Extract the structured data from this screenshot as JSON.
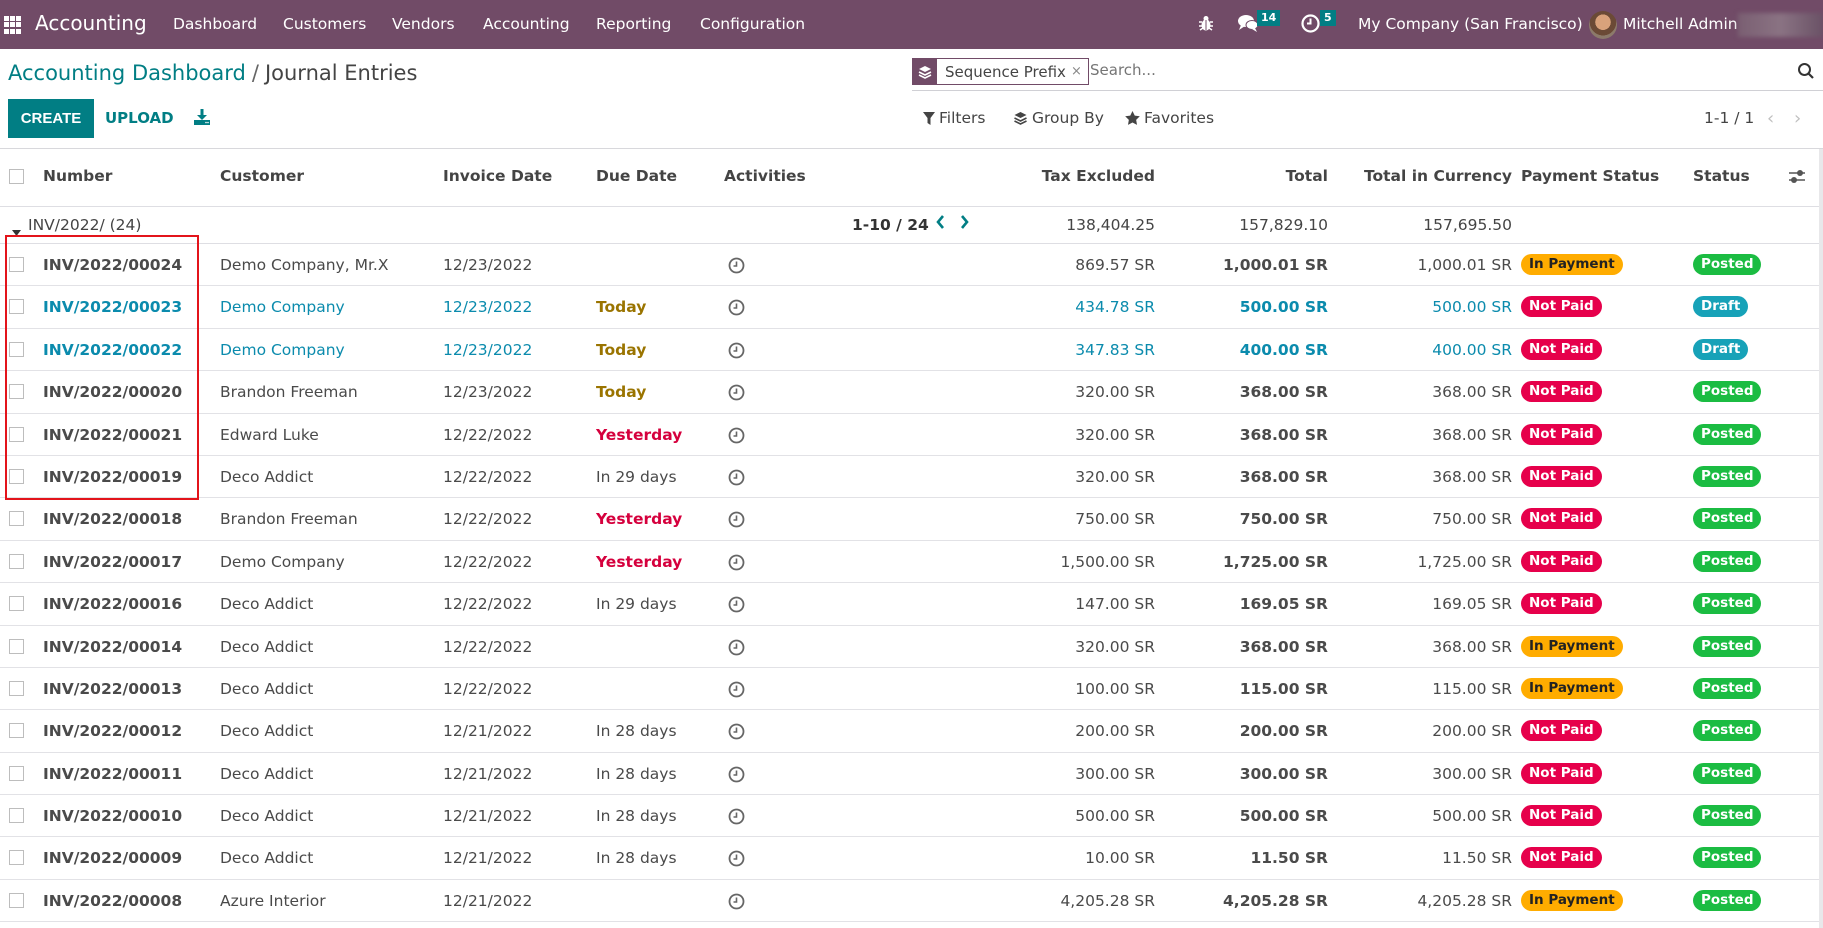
{
  "navbar": {
    "app_name": "Accounting",
    "menu": [
      "Dashboard",
      "Customers",
      "Vendors",
      "Accounting",
      "Reporting",
      "Configuration"
    ],
    "messages_count": "14",
    "activities_count": "5",
    "company": "My Company (San Francisco)",
    "user": "Mitchell Admin"
  },
  "breadcrumb": {
    "parent": "Accounting Dashboard",
    "separator": "/",
    "current": "Journal Entries"
  },
  "toolbar": {
    "create_label": "CREATE",
    "upload_label": "UPLOAD"
  },
  "search": {
    "facet_label": "Sequence Prefix",
    "facet_close": "×",
    "placeholder": "Search...",
    "filters_label": "Filters",
    "groupby_label": "Group By",
    "favorites_label": "Favorites"
  },
  "pager": {
    "value": "1-1 / 1",
    "prev": "‹",
    "next": "›"
  },
  "table": {
    "columns": [
      "Number",
      "Customer",
      "Invoice Date",
      "Due Date",
      "Activities",
      "Tax Excluded",
      "Total",
      "Total in Currency",
      "Payment Status",
      "Status"
    ],
    "group": {
      "label": "INV/2022/ (24)",
      "pager": "1-10 / 24",
      "tax_excluded": "138,404.25",
      "total": "157,829.10",
      "total_in_currency": "157,695.50"
    },
    "rows": [
      {
        "number": "INV/2022/00024",
        "customer": "Demo Company, Mr.X",
        "invoice_date": "12/23/2022",
        "due_date": "",
        "due_kind": "",
        "tax_excluded": "869.57 SR",
        "total": "1,000.01 SR",
        "total_in_currency": "1,000.01 SR",
        "payment_status": "In Payment",
        "payment_kind": "in-payment",
        "status": "Posted",
        "status_kind": "posted"
      },
      {
        "number": "INV/2022/00023",
        "customer": "Demo Company",
        "invoice_date": "12/23/2022",
        "due_date": "Today",
        "due_kind": "today",
        "tax_excluded": "434.78 SR",
        "total": "500.00 SR",
        "total_in_currency": "500.00 SR",
        "payment_status": "Not Paid",
        "payment_kind": "not-paid",
        "status": "Draft",
        "status_kind": "draft"
      },
      {
        "number": "INV/2022/00022",
        "customer": "Demo Company",
        "invoice_date": "12/23/2022",
        "due_date": "Today",
        "due_kind": "today",
        "tax_excluded": "347.83 SR",
        "total": "400.00 SR",
        "total_in_currency": "400.00 SR",
        "payment_status": "Not Paid",
        "payment_kind": "not-paid",
        "status": "Draft",
        "status_kind": "draft"
      },
      {
        "number": "INV/2022/00020",
        "customer": "Brandon Freeman",
        "invoice_date": "12/23/2022",
        "due_date": "Today",
        "due_kind": "today",
        "tax_excluded": "320.00 SR",
        "total": "368.00 SR",
        "total_in_currency": "368.00 SR",
        "payment_status": "Not Paid",
        "payment_kind": "not-paid",
        "status": "Posted",
        "status_kind": "posted"
      },
      {
        "number": "INV/2022/00021",
        "customer": "Edward Luke",
        "invoice_date": "12/22/2022",
        "due_date": "Yesterday",
        "due_kind": "late",
        "tax_excluded": "320.00 SR",
        "total": "368.00 SR",
        "total_in_currency": "368.00 SR",
        "payment_status": "Not Paid",
        "payment_kind": "not-paid",
        "status": "Posted",
        "status_kind": "posted"
      },
      {
        "number": "INV/2022/00019",
        "customer": "Deco Addict",
        "invoice_date": "12/22/2022",
        "due_date": "In 29 days",
        "due_kind": "",
        "tax_excluded": "320.00 SR",
        "total": "368.00 SR",
        "total_in_currency": "368.00 SR",
        "payment_status": "Not Paid",
        "payment_kind": "not-paid",
        "status": "Posted",
        "status_kind": "posted"
      },
      {
        "number": "INV/2022/00018",
        "customer": "Brandon Freeman",
        "invoice_date": "12/22/2022",
        "due_date": "Yesterday",
        "due_kind": "late",
        "tax_excluded": "750.00 SR",
        "total": "750.00 SR",
        "total_in_currency": "750.00 SR",
        "payment_status": "Not Paid",
        "payment_kind": "not-paid",
        "status": "Posted",
        "status_kind": "posted"
      },
      {
        "number": "INV/2022/00017",
        "customer": "Demo Company",
        "invoice_date": "12/22/2022",
        "due_date": "Yesterday",
        "due_kind": "late",
        "tax_excluded": "1,500.00 SR",
        "total": "1,725.00 SR",
        "total_in_currency": "1,725.00 SR",
        "payment_status": "Not Paid",
        "payment_kind": "not-paid",
        "status": "Posted",
        "status_kind": "posted"
      },
      {
        "number": "INV/2022/00016",
        "customer": "Deco Addict",
        "invoice_date": "12/22/2022",
        "due_date": "In 29 days",
        "due_kind": "",
        "tax_excluded": "147.00 SR",
        "total": "169.05 SR",
        "total_in_currency": "169.05 SR",
        "payment_status": "Not Paid",
        "payment_kind": "not-paid",
        "status": "Posted",
        "status_kind": "posted"
      },
      {
        "number": "INV/2022/00014",
        "customer": "Deco Addict",
        "invoice_date": "12/22/2022",
        "due_date": "",
        "due_kind": "",
        "tax_excluded": "320.00 SR",
        "total": "368.00 SR",
        "total_in_currency": "368.00 SR",
        "payment_status": "In Payment",
        "payment_kind": "in-payment",
        "status": "Posted",
        "status_kind": "posted"
      },
      {
        "number": "INV/2022/00013",
        "customer": "Deco Addict",
        "invoice_date": "12/22/2022",
        "due_date": "",
        "due_kind": "",
        "tax_excluded": "100.00 SR",
        "total": "115.00 SR",
        "total_in_currency": "115.00 SR",
        "payment_status": "In Payment",
        "payment_kind": "in-payment",
        "status": "Posted",
        "status_kind": "posted"
      },
      {
        "number": "INV/2022/00012",
        "customer": "Deco Addict",
        "invoice_date": "12/21/2022",
        "due_date": "In 28 days",
        "due_kind": "",
        "tax_excluded": "200.00 SR",
        "total": "200.00 SR",
        "total_in_currency": "200.00 SR",
        "payment_status": "Not Paid",
        "payment_kind": "not-paid",
        "status": "Posted",
        "status_kind": "posted"
      },
      {
        "number": "INV/2022/00011",
        "customer": "Deco Addict",
        "invoice_date": "12/21/2022",
        "due_date": "In 28 days",
        "due_kind": "",
        "tax_excluded": "300.00 SR",
        "total": "300.00 SR",
        "total_in_currency": "300.00 SR",
        "payment_status": "Not Paid",
        "payment_kind": "not-paid",
        "status": "Posted",
        "status_kind": "posted"
      },
      {
        "number": "INV/2022/00010",
        "customer": "Deco Addict",
        "invoice_date": "12/21/2022",
        "due_date": "In 28 days",
        "due_kind": "",
        "tax_excluded": "500.00 SR",
        "total": "500.00 SR",
        "total_in_currency": "500.00 SR",
        "payment_status": "Not Paid",
        "payment_kind": "not-paid",
        "status": "Posted",
        "status_kind": "posted"
      },
      {
        "number": "INV/2022/00009",
        "customer": "Deco Addict",
        "invoice_date": "12/21/2022",
        "due_date": "In 28 days",
        "due_kind": "",
        "tax_excluded": "10.00 SR",
        "total": "11.50 SR",
        "total_in_currency": "11.50 SR",
        "payment_status": "Not Paid",
        "payment_kind": "not-paid",
        "status": "Posted",
        "status_kind": "posted"
      },
      {
        "number": "INV/2022/00008",
        "customer": "Azure Interior",
        "invoice_date": "12/21/2022",
        "due_date": "",
        "due_kind": "",
        "tax_excluded": "4,205.28 SR",
        "total": "4,205.28 SR",
        "total_in_currency": "4,205.28 SR",
        "payment_status": "In Payment",
        "payment_kind": "in-payment",
        "status": "Posted",
        "status_kind": "posted"
      }
    ]
  },
  "colors": {
    "brand": "#714b67",
    "accent": "#017e84",
    "in_payment": "#ffac00",
    "not_paid": "#e6004b",
    "posted": "#1bbc42",
    "draft": "#17a2b8",
    "highlight": "#e3141b"
  }
}
